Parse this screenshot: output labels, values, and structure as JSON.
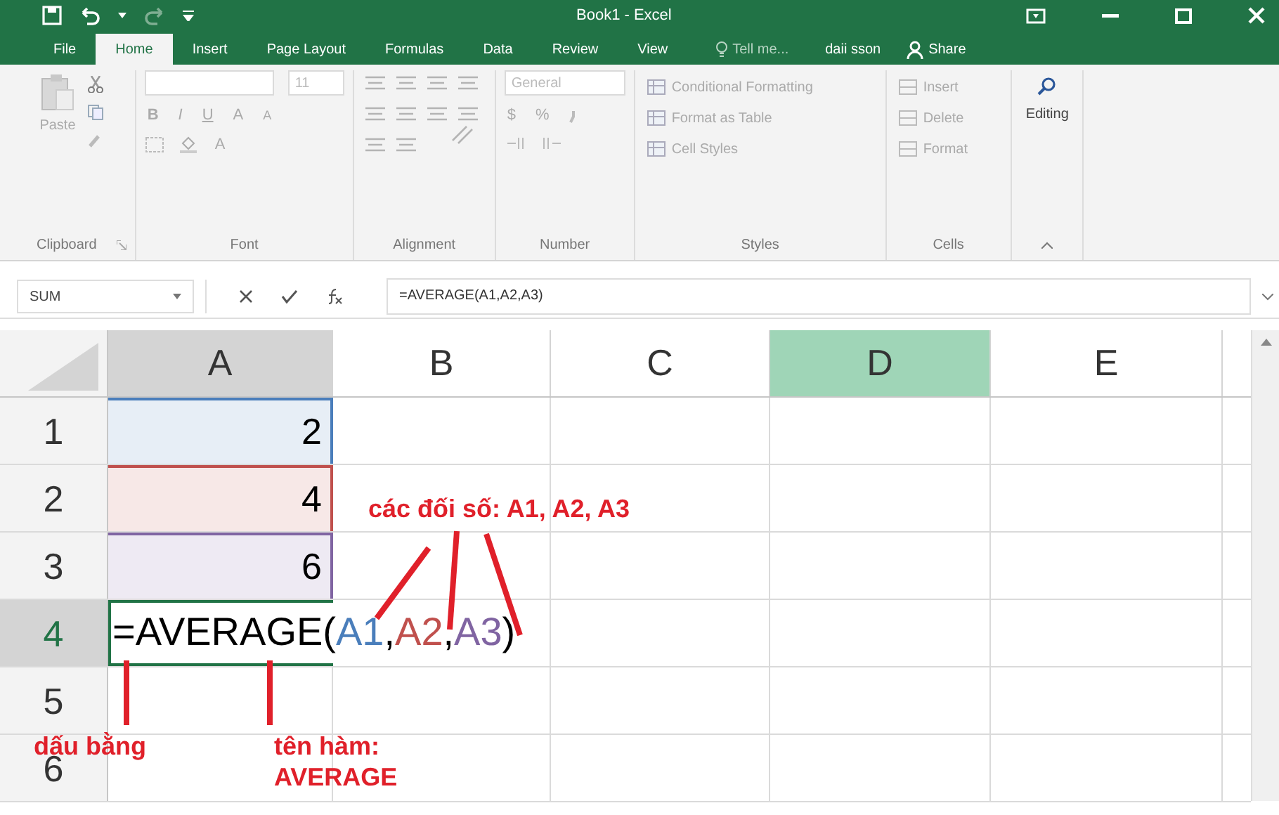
{
  "window": {
    "title": "Book1 - Excel"
  },
  "tabs": [
    {
      "label": "File",
      "selected": false
    },
    {
      "label": "Home",
      "selected": true
    },
    {
      "label": "Insert",
      "selected": false
    },
    {
      "label": "Page Layout",
      "selected": false
    },
    {
      "label": "Formulas",
      "selected": false
    },
    {
      "label": "Data",
      "selected": false
    },
    {
      "label": "Review",
      "selected": false
    },
    {
      "label": "View",
      "selected": false
    }
  ],
  "tell_me": {
    "placeholder": "Tell me..."
  },
  "user": "daii sson",
  "share": "Share",
  "ribbon": {
    "clipboard": {
      "label": "Clipboard",
      "paste": "Paste"
    },
    "font": {
      "label": "Font",
      "size": "11",
      "bold": "B",
      "italic": "I",
      "underline": "U",
      "grow": "A",
      "shrink": "A",
      "font_color": "A"
    },
    "alignment": {
      "label": "Alignment"
    },
    "number": {
      "label": "Number",
      "format": "General",
      "currency": "$",
      "percent": "%"
    },
    "styles": {
      "label": "Styles",
      "items": [
        "Conditional Formatting",
        "Format as Table",
        "Cell Styles"
      ]
    },
    "cells": {
      "label": "Cells",
      "items": [
        "Insert",
        "Delete",
        "Format"
      ]
    },
    "editing": {
      "label": "Editing"
    }
  },
  "name_box": "SUM",
  "formula_bar": "=AVERAGE(A1,A2,A3)",
  "columns": [
    {
      "label": "A",
      "selected": false,
      "highlighted": true
    },
    {
      "label": "B",
      "selected": false,
      "highlighted": false
    },
    {
      "label": "C",
      "selected": false,
      "highlighted": false
    },
    {
      "label": "D",
      "selected": true,
      "highlighted": false
    },
    {
      "label": "E",
      "selected": false,
      "highlighted": false
    }
  ],
  "rows": [
    {
      "label": "1",
      "highlighted": false,
      "value": "2",
      "color": "#4a7ebb"
    },
    {
      "label": "2",
      "highlighted": false,
      "value": "4",
      "color": "#c0504d"
    },
    {
      "label": "3",
      "highlighted": false,
      "value": "6",
      "color": "#8064a2"
    },
    {
      "label": "4",
      "highlighted": true,
      "kind": "formula"
    },
    {
      "label": "5",
      "highlighted": false
    },
    {
      "label": "6",
      "highlighted": false
    }
  ],
  "formula_parts": [
    {
      "text": "=AVERAGE(",
      "color": "#000000"
    },
    {
      "text": "A1",
      "color": "#4a7ebb"
    },
    {
      "text": ",",
      "color": "#000000"
    },
    {
      "text": "A2",
      "color": "#c0504d"
    },
    {
      "text": ",",
      "color": "#000000"
    },
    {
      "text": "A3",
      "color": "#8064a2"
    },
    {
      "text": ")",
      "color": "#000000"
    }
  ],
  "annotations": [
    {
      "text": "các đối số: A1, A2, A3"
    },
    {
      "text": "dấu bằng"
    },
    {
      "text": "tên hàm:\nAVERAGE"
    }
  ]
}
